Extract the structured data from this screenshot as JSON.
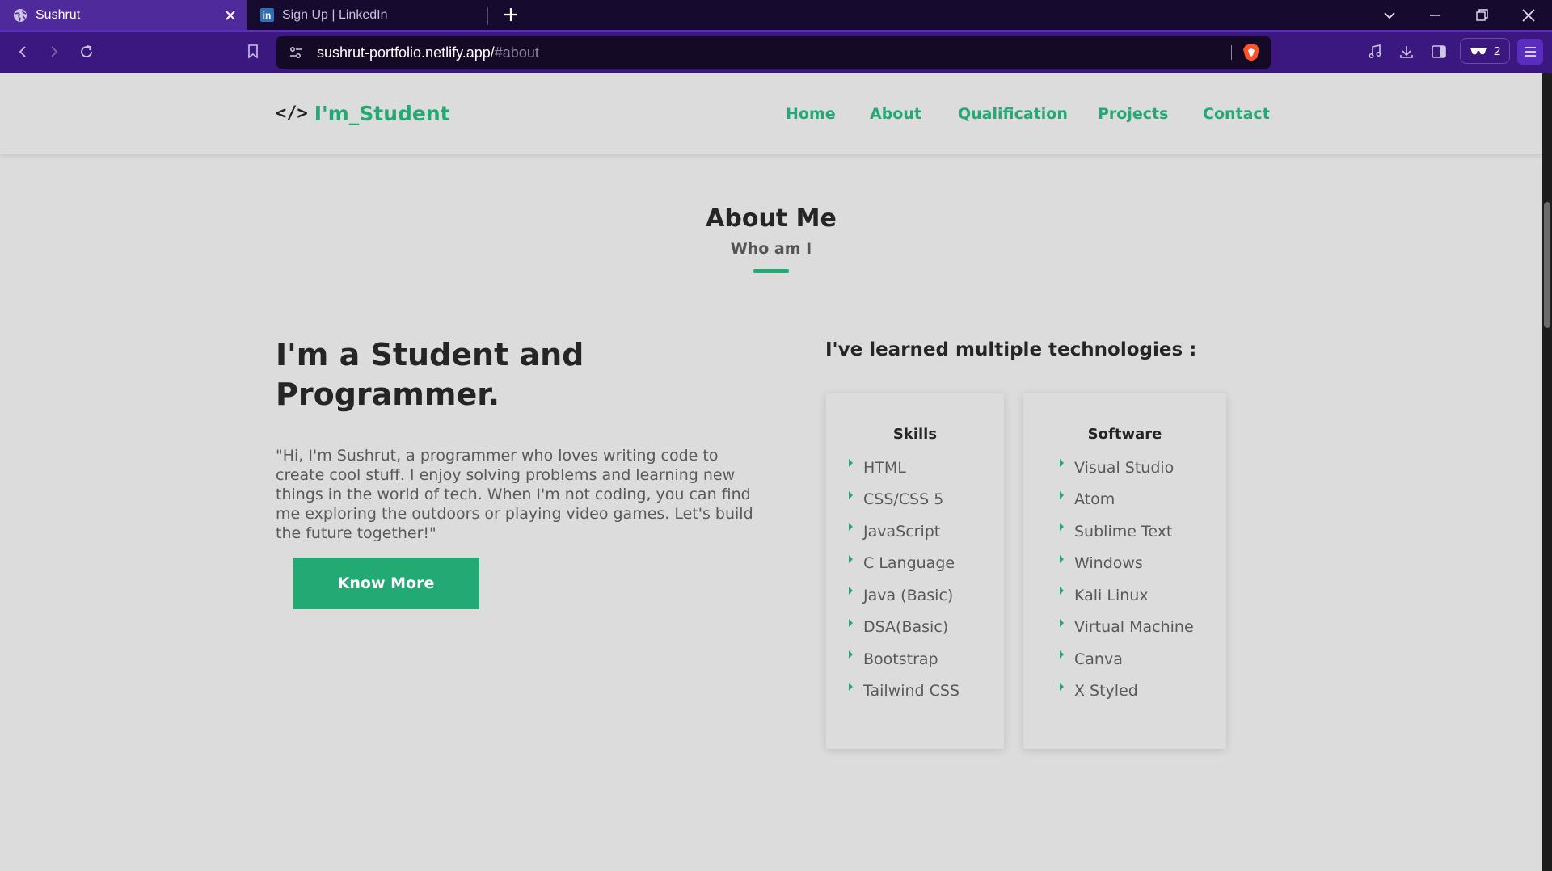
{
  "browser": {
    "tabs": [
      {
        "title": "Sushrut",
        "active": true
      },
      {
        "title": "Sign Up | LinkedIn",
        "active": false
      }
    ],
    "linkedin_mark": "in",
    "url_host": "sushrut-portfolio.netlify.app/",
    "url_hash": "#about",
    "wallet_count": "2",
    "accent_color": "#4e2a9a"
  },
  "site": {
    "logo_text": "I'm_Student",
    "logo_icon": "</>",
    "nav": [
      "Home",
      "About",
      "Qualification",
      "Projects",
      "Contact"
    ],
    "accent_color": "#23a974"
  },
  "about": {
    "title": "About Me",
    "subtitle": "Who am I",
    "headline_line1": "I'm a Student and",
    "headline_line2": "Programmer.",
    "intro": "\"Hi, I'm Sushrut, a programmer who loves writing code to create cool stuff. I enjoy solving problems and learning new things in the world of tech. When I'm not coding, you can find me exploring the outdoors or playing video games. Let's build the future together!\"",
    "button_label": "Know More",
    "tech_title": "I've learned multiple technologies :"
  },
  "skills": {
    "title": "Skills",
    "items": [
      "HTML",
      "CSS/CSS 5",
      "JavaScript",
      "C Language",
      "Java (Basic)",
      "DSA(Basic)",
      "Bootstrap",
      "Tailwind CSS"
    ]
  },
  "software": {
    "title": "Software",
    "items": [
      "Visual Studio",
      "Atom",
      "Sublime Text",
      "Windows",
      "Kali Linux",
      "Virtual Machine",
      "Canva",
      "X Styled"
    ]
  }
}
